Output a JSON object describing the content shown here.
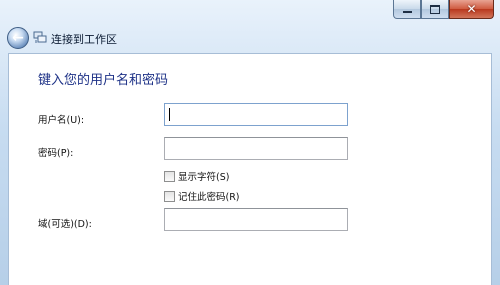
{
  "window": {
    "nav_title": "连接到工作区",
    "close_glyph": "✕"
  },
  "form": {
    "heading": "键入您的用户名和密码",
    "username_label": "用户名(U):",
    "username_value": "",
    "password_label": "密码(P):",
    "password_value": "",
    "show_chars_label": "显示字符(S)",
    "show_chars_checked": false,
    "remember_label": "记住此密码(R)",
    "remember_checked": false,
    "domain_label": "域(可选)(D):",
    "domain_value": ""
  },
  "icons": {
    "back": "back-arrow-icon",
    "network": "network-connection-icon"
  },
  "colors": {
    "heading": "#1e3287",
    "frame": "#c7dcf1",
    "close": "#cf5a3f"
  }
}
